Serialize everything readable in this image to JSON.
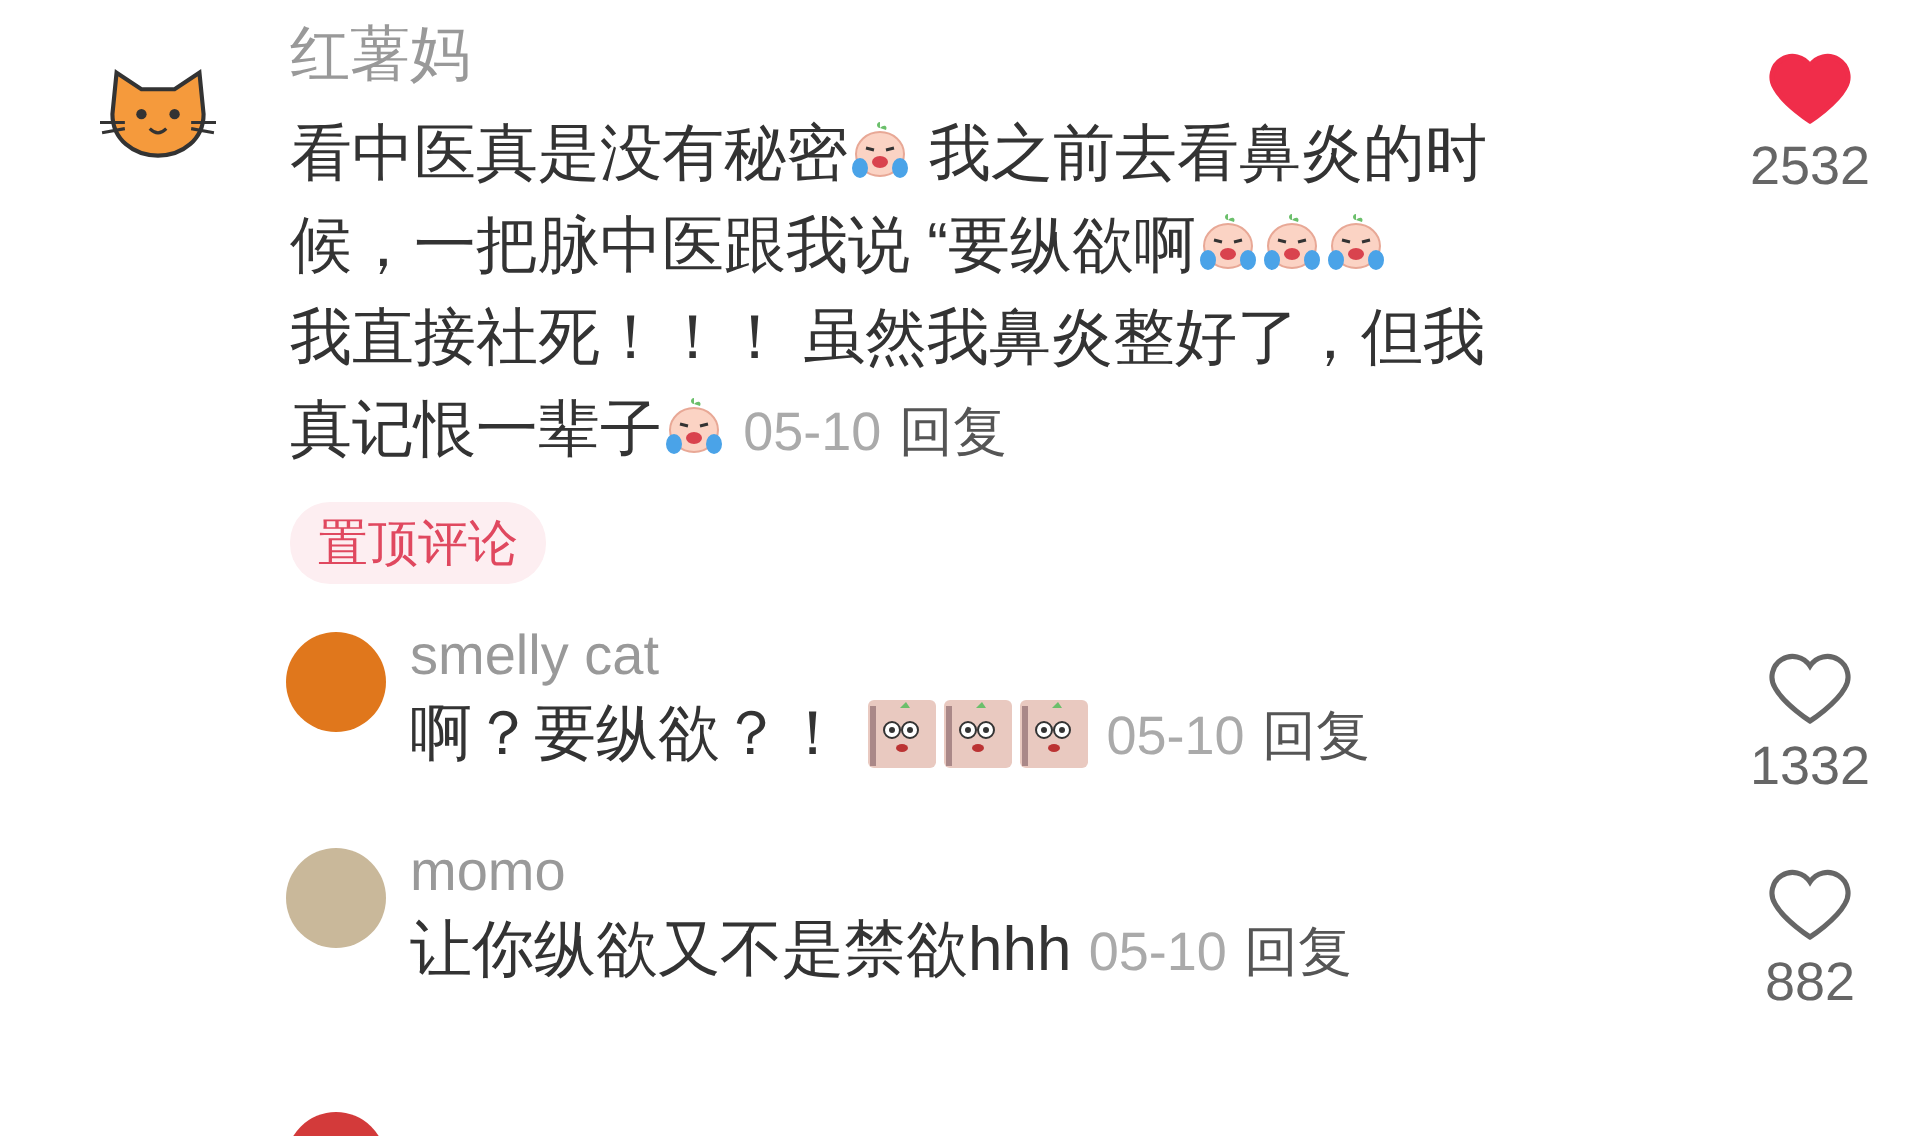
{
  "comment": {
    "author": "红薯妈",
    "body": [
      {
        "kind": "text",
        "text": "看中医真是没有秘密"
      },
      {
        "kind": "crying-emoji"
      },
      {
        "kind": "text",
        "text": " 我之前去看鼻炎的时"
      },
      {
        "kind": "text",
        "text": "候，一把脉中医跟我说 “要纵欲啊"
      },
      {
        "kind": "crying-emoji"
      },
      {
        "kind": "crying-emoji"
      },
      {
        "kind": "crying-emoji"
      },
      {
        "kind": "text",
        "text": "我直接社死！！！ 虽然我鼻炎整好了，但我"
      },
      {
        "kind": "text",
        "text": "真记恨一辈子"
      },
      {
        "kind": "crying-emoji"
      }
    ],
    "date": "05-10",
    "reply": "回复",
    "tag": "置顶评论",
    "liked": true,
    "likes": "2532"
  },
  "replies": [
    {
      "author": "smelly cat",
      "body": [
        {
          "kind": "text",
          "text": "啊？要纵欲？！ "
        },
        {
          "kind": "sticker"
        },
        {
          "kind": "sticker"
        },
        {
          "kind": "sticker"
        }
      ],
      "date": "05-10",
      "reply": "回复",
      "liked": false,
      "likes": "1332"
    },
    {
      "author": "momo",
      "body": [
        {
          "kind": "text",
          "text": "让你纵欲又不是禁欲hhh"
        }
      ],
      "date": "05-10",
      "reply": "回复",
      "liked": false,
      "likes": "882"
    }
  ]
}
